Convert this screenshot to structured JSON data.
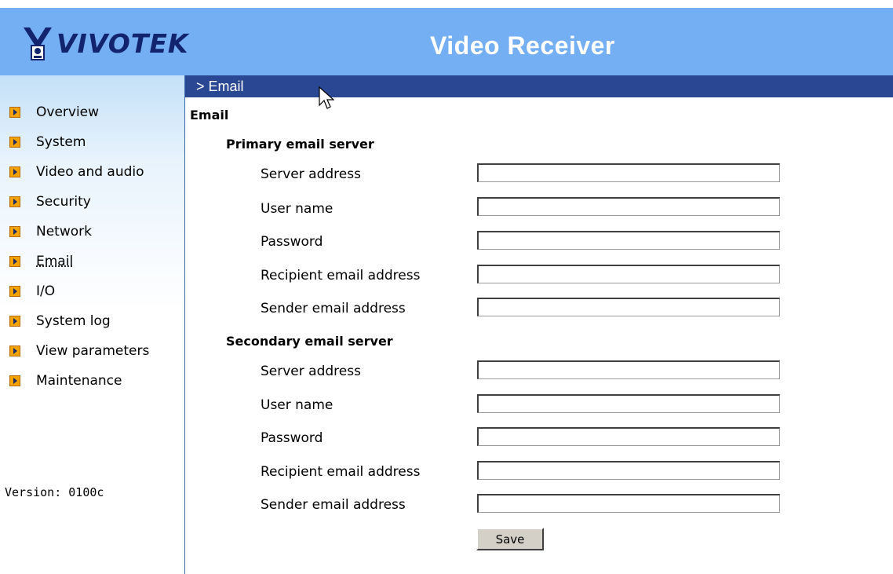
{
  "header": {
    "logo_text": "VIVOTEK",
    "title": "Video Receiver"
  },
  "sidebar": {
    "items": [
      {
        "label": "Overview"
      },
      {
        "label": "System"
      },
      {
        "label": "Video and audio"
      },
      {
        "label": "Security"
      },
      {
        "label": "Network"
      },
      {
        "label": "Email",
        "active": true
      },
      {
        "label": "I/O"
      },
      {
        "label": "System log"
      },
      {
        "label": "View parameters"
      },
      {
        "label": "Maintenance"
      }
    ],
    "version": "Version: 0100c"
  },
  "breadcrumb": "> Email",
  "main": {
    "title": "Email",
    "primary": {
      "title": "Primary email server",
      "fields": [
        {
          "label": "Server address",
          "value": ""
        },
        {
          "label": "User name",
          "value": ""
        },
        {
          "label": "Password",
          "value": ""
        },
        {
          "label": "Recipient email address",
          "value": ""
        },
        {
          "label": "Sender email address",
          "value": ""
        }
      ]
    },
    "secondary": {
      "title": "Secondary email server",
      "fields": [
        {
          "label": "Server address",
          "value": ""
        },
        {
          "label": "User name",
          "value": ""
        },
        {
          "label": "Password",
          "value": ""
        },
        {
          "label": "Recipient email address",
          "value": ""
        },
        {
          "label": "Sender email address",
          "value": ""
        }
      ]
    },
    "save_label": "Save"
  },
  "colors": {
    "header_bg": "#74aef3",
    "breadcrumb_bg": "#2a4794",
    "logo_color": "#13246e",
    "arrow_icon": "#f3a200"
  }
}
